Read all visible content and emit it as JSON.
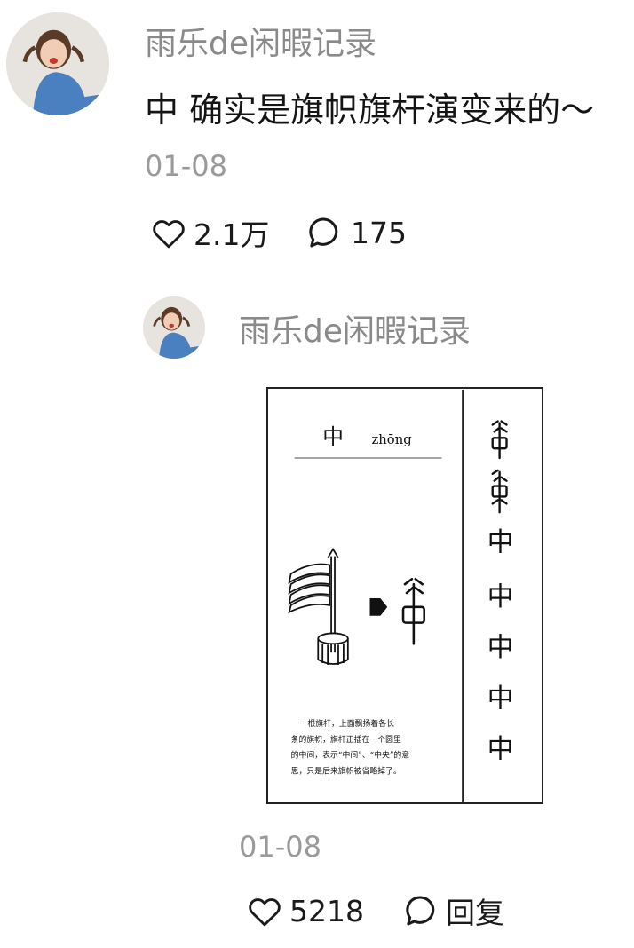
{
  "comment": {
    "username": "雨乐de闲暇记录",
    "text": "中 确实是旗帜旗杆演变来的～",
    "date": "01-08",
    "likes": "2.1万",
    "replies": "175"
  },
  "reply": {
    "username": "雨乐de闲暇记录",
    "date": "01-08",
    "likes": "5218",
    "reply_label": "回复",
    "image": {
      "heading_char": "中",
      "pinyin": "zhōng",
      "evolution_glyphs": [
        "𠁧",
        "𠁧",
        "中",
        "中",
        "中",
        "中",
        "中"
      ],
      "caption_lines": [
        "一根旗杆，上面飘扬着各长",
        "条的旗帜，旗杆正插在一个圆里",
        "的中间，表示“中间”、“中央”的意",
        "思，只是后来旗帜被省略掉了。"
      ]
    }
  },
  "icons": {
    "like": "heart-outline-icon",
    "comment": "speech-bubble-icon"
  }
}
